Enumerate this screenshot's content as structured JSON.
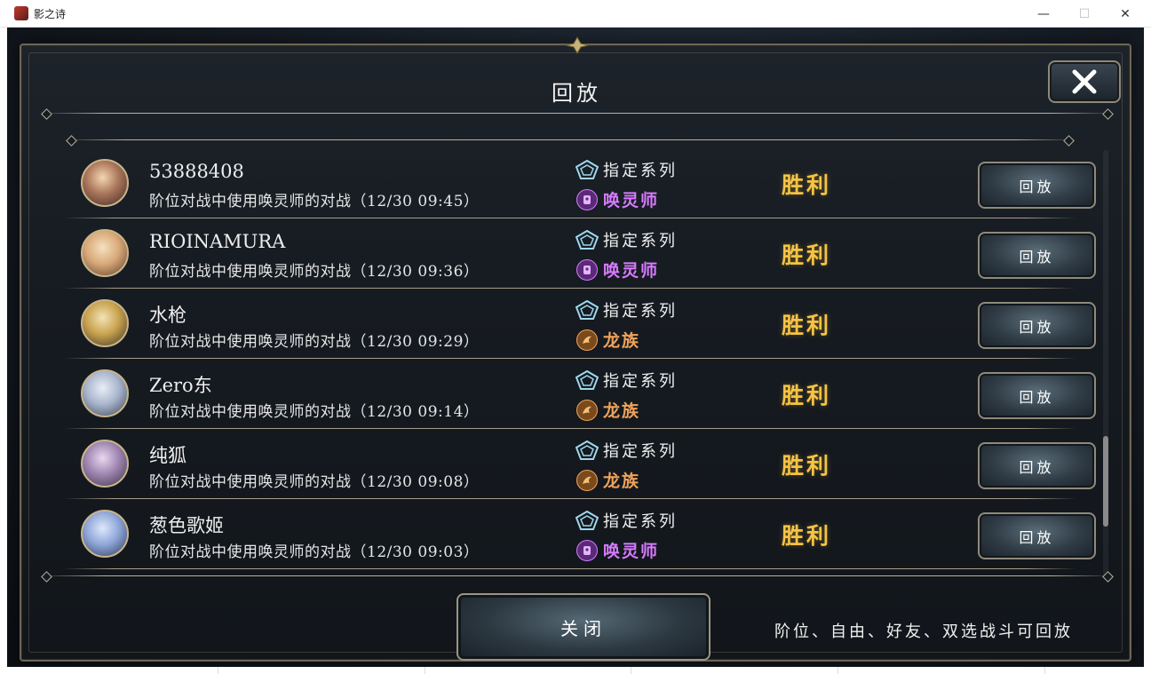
{
  "window": {
    "title": "影之诗",
    "minimize_glyph": "—",
    "maximize_glyph": "☐",
    "close_glyph": "✕"
  },
  "dialog": {
    "title": "回放",
    "close_icon": "x-icon",
    "close_button_label": "关闭",
    "footer_note": "阶位、自由、好友、双选战斗可回放"
  },
  "replays": [
    {
      "player": "53888408",
      "description": "阶位对战中使用唤灵师的对战（12/30 09:45）",
      "format": "指定系列",
      "class_name": "唤灵师",
      "class_icon": "necromancer-icon",
      "class_color": "#d77bff",
      "result": "胜利",
      "replay_label": "回放"
    },
    {
      "player": "RIOINAMURA",
      "description": "阶位对战中使用唤灵师的对战（12/30 09:36）",
      "format": "指定系列",
      "class_name": "唤灵师",
      "class_icon": "necromancer-icon",
      "class_color": "#d77bff",
      "result": "胜利",
      "replay_label": "回放"
    },
    {
      "player": "水枪",
      "description": "阶位对战中使用唤灵师的对战（12/30 09:29）",
      "format": "指定系列",
      "class_name": "龙族",
      "class_icon": "dragon-icon",
      "class_color": "#f0a35a",
      "result": "胜利",
      "replay_label": "回放"
    },
    {
      "player": "Zero东",
      "description": "阶位对战中使用唤灵师的对战（12/30 09:14）",
      "format": "指定系列",
      "class_name": "龙族",
      "class_icon": "dragon-icon",
      "class_color": "#f0a35a",
      "result": "胜利",
      "replay_label": "回放"
    },
    {
      "player": "纯狐",
      "description": "阶位对战中使用唤灵师的对战（12/30 09:08）",
      "format": "指定系列",
      "class_name": "龙族",
      "class_icon": "dragon-icon",
      "class_color": "#f0a35a",
      "result": "胜利",
      "replay_label": "回放"
    },
    {
      "player": "葱色歌姬",
      "description": "阶位对战中使用唤灵师的对战（12/30 09:03）",
      "format": "指定系列",
      "class_name": "唤灵师",
      "class_icon": "necromancer-icon",
      "class_color": "#d77bff",
      "result": "胜利",
      "replay_label": "回放"
    }
  ],
  "colors": {
    "result": "#f6c343",
    "frame": "#8e8a7c",
    "format_icon": "#9fd8ee"
  }
}
